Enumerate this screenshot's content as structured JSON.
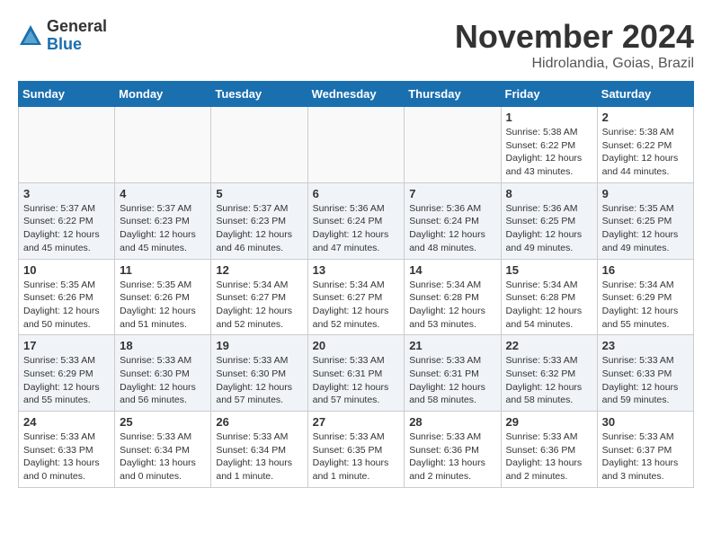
{
  "header": {
    "logo_general": "General",
    "logo_blue": "Blue",
    "month_title": "November 2024",
    "location": "Hidrolandia, Goias, Brazil"
  },
  "days_of_week": [
    "Sunday",
    "Monday",
    "Tuesday",
    "Wednesday",
    "Thursday",
    "Friday",
    "Saturday"
  ],
  "weeks": [
    [
      {
        "day": "",
        "info": ""
      },
      {
        "day": "",
        "info": ""
      },
      {
        "day": "",
        "info": ""
      },
      {
        "day": "",
        "info": ""
      },
      {
        "day": "",
        "info": ""
      },
      {
        "day": "1",
        "info": "Sunrise: 5:38 AM\nSunset: 6:22 PM\nDaylight: 12 hours and 43 minutes."
      },
      {
        "day": "2",
        "info": "Sunrise: 5:38 AM\nSunset: 6:22 PM\nDaylight: 12 hours and 44 minutes."
      }
    ],
    [
      {
        "day": "3",
        "info": "Sunrise: 5:37 AM\nSunset: 6:22 PM\nDaylight: 12 hours and 45 minutes."
      },
      {
        "day": "4",
        "info": "Sunrise: 5:37 AM\nSunset: 6:23 PM\nDaylight: 12 hours and 45 minutes."
      },
      {
        "day": "5",
        "info": "Sunrise: 5:37 AM\nSunset: 6:23 PM\nDaylight: 12 hours and 46 minutes."
      },
      {
        "day": "6",
        "info": "Sunrise: 5:36 AM\nSunset: 6:24 PM\nDaylight: 12 hours and 47 minutes."
      },
      {
        "day": "7",
        "info": "Sunrise: 5:36 AM\nSunset: 6:24 PM\nDaylight: 12 hours and 48 minutes."
      },
      {
        "day": "8",
        "info": "Sunrise: 5:36 AM\nSunset: 6:25 PM\nDaylight: 12 hours and 49 minutes."
      },
      {
        "day": "9",
        "info": "Sunrise: 5:35 AM\nSunset: 6:25 PM\nDaylight: 12 hours and 49 minutes."
      }
    ],
    [
      {
        "day": "10",
        "info": "Sunrise: 5:35 AM\nSunset: 6:26 PM\nDaylight: 12 hours and 50 minutes."
      },
      {
        "day": "11",
        "info": "Sunrise: 5:35 AM\nSunset: 6:26 PM\nDaylight: 12 hours and 51 minutes."
      },
      {
        "day": "12",
        "info": "Sunrise: 5:34 AM\nSunset: 6:27 PM\nDaylight: 12 hours and 52 minutes."
      },
      {
        "day": "13",
        "info": "Sunrise: 5:34 AM\nSunset: 6:27 PM\nDaylight: 12 hours and 52 minutes."
      },
      {
        "day": "14",
        "info": "Sunrise: 5:34 AM\nSunset: 6:28 PM\nDaylight: 12 hours and 53 minutes."
      },
      {
        "day": "15",
        "info": "Sunrise: 5:34 AM\nSunset: 6:28 PM\nDaylight: 12 hours and 54 minutes."
      },
      {
        "day": "16",
        "info": "Sunrise: 5:34 AM\nSunset: 6:29 PM\nDaylight: 12 hours and 55 minutes."
      }
    ],
    [
      {
        "day": "17",
        "info": "Sunrise: 5:33 AM\nSunset: 6:29 PM\nDaylight: 12 hours and 55 minutes."
      },
      {
        "day": "18",
        "info": "Sunrise: 5:33 AM\nSunset: 6:30 PM\nDaylight: 12 hours and 56 minutes."
      },
      {
        "day": "19",
        "info": "Sunrise: 5:33 AM\nSunset: 6:30 PM\nDaylight: 12 hours and 57 minutes."
      },
      {
        "day": "20",
        "info": "Sunrise: 5:33 AM\nSunset: 6:31 PM\nDaylight: 12 hours and 57 minutes."
      },
      {
        "day": "21",
        "info": "Sunrise: 5:33 AM\nSunset: 6:31 PM\nDaylight: 12 hours and 58 minutes."
      },
      {
        "day": "22",
        "info": "Sunrise: 5:33 AM\nSunset: 6:32 PM\nDaylight: 12 hours and 58 minutes."
      },
      {
        "day": "23",
        "info": "Sunrise: 5:33 AM\nSunset: 6:33 PM\nDaylight: 12 hours and 59 minutes."
      }
    ],
    [
      {
        "day": "24",
        "info": "Sunrise: 5:33 AM\nSunset: 6:33 PM\nDaylight: 13 hours and 0 minutes."
      },
      {
        "day": "25",
        "info": "Sunrise: 5:33 AM\nSunset: 6:34 PM\nDaylight: 13 hours and 0 minutes."
      },
      {
        "day": "26",
        "info": "Sunrise: 5:33 AM\nSunset: 6:34 PM\nDaylight: 13 hours and 1 minute."
      },
      {
        "day": "27",
        "info": "Sunrise: 5:33 AM\nSunset: 6:35 PM\nDaylight: 13 hours and 1 minute."
      },
      {
        "day": "28",
        "info": "Sunrise: 5:33 AM\nSunset: 6:36 PM\nDaylight: 13 hours and 2 minutes."
      },
      {
        "day": "29",
        "info": "Sunrise: 5:33 AM\nSunset: 6:36 PM\nDaylight: 13 hours and 2 minutes."
      },
      {
        "day": "30",
        "info": "Sunrise: 5:33 AM\nSunset: 6:37 PM\nDaylight: 13 hours and 3 minutes."
      }
    ]
  ]
}
